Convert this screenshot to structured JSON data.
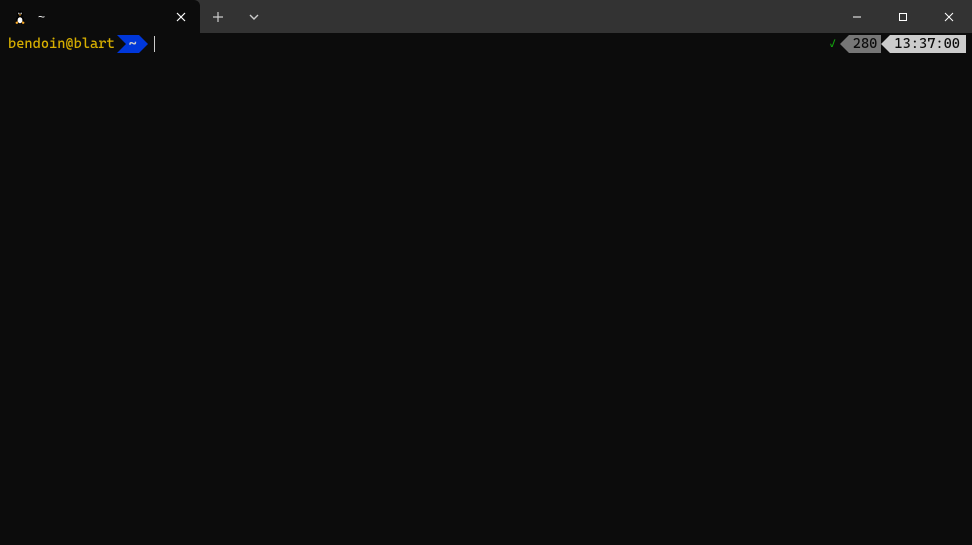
{
  "window": {
    "tab_title": "~"
  },
  "prompt": {
    "user_host": "bendoin@blart",
    "path": "~",
    "input": ""
  },
  "status": {
    "success": "✓",
    "history_count": "280",
    "time": "13:37:00"
  },
  "colors": {
    "bg": "#0c0c0c",
    "titlebar": "#333333",
    "user_fg": "#d7af00",
    "path_bg": "#0037da",
    "right_mid_bg": "#767676",
    "right_time_bg": "#cccccc",
    "success_fg": "#13a10e"
  }
}
